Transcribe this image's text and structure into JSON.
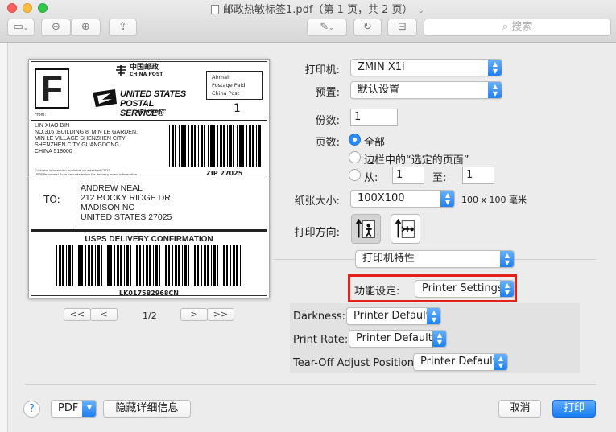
{
  "window": {
    "title": "邮政热敏标签1.pdf（第 1 页，共 2 页）",
    "search_placeholder": "搜索"
  },
  "label": {
    "sort_letter": "F",
    "from_label": "From:",
    "china_post_cn": "中国邮政",
    "china_post_en": "CHINA POST",
    "usps_line1": "UNITED STATES",
    "usps_line2": "POSTAL SERVICE®",
    "epacket": "ePacket™",
    "airmail_lines": [
      "Airmail",
      "Postage Paid",
      "China Post"
    ],
    "box_number": "1",
    "sender_lines": [
      "LIN XIAO BIN",
      "NO.316 ,BUILDING 8, MIN LE GARDEN,",
      "MIN LE VILLAGE SHENZHEN CITY",
      "SHENZHEN CITY GUANGDONG",
      "CHINA 518000"
    ],
    "customs_lines": [
      "Customs information available on attached CN22.",
      "USPS Personnel Scan barcode below for delivery event information"
    ],
    "zip": "ZIP 27025",
    "to_label": "TO:",
    "recipient_lines": [
      "ANDREW NEAL",
      "212 ROCKY RIDGE DR",
      "MADISON NC",
      "UNITED STATES 27025"
    ],
    "confirmation": "USPS DELIVERY CONFIRMATION",
    "tracking": "LK017582968CN"
  },
  "pager": {
    "first": "<<",
    "prev": "<",
    "indicator": "1/2",
    "next": ">",
    "last": ">>"
  },
  "form": {
    "printer_label": "打印机:",
    "printer_value": "ZMIN X1i",
    "preset_label": "预置:",
    "preset_value": "默认设置",
    "copies_label": "份数:",
    "copies_value": "1",
    "pages_label": "页数:",
    "pages_all": "全部",
    "pages_selected": "边栏中的“选定的页面”",
    "pages_from": "从:",
    "pages_from_value": "1",
    "pages_to": "至:",
    "pages_to_value": "1",
    "paper_label": "纸张大小:",
    "paper_value": "100X100",
    "paper_dims": "100 x 100 毫米",
    "orientation_label": "打印方向:",
    "section_value": "打印机特性",
    "feature_label": "功能设定:",
    "feature_value": "Printer Settings",
    "darkness_label": "Darkness:",
    "darkness_value": "Printer Default",
    "rate_label": "Print Rate:",
    "rate_value": "Printer Default",
    "tearoff_label": "Tear-Off Adjust Position:",
    "tearoff_value": "Printer Default"
  },
  "footer": {
    "help": "?",
    "pdf": "PDF",
    "hide_details": "隐藏详细信息",
    "cancel": "取消",
    "print": "打印"
  },
  "colors": {
    "accent": "#1a7cf2",
    "highlight_box": "#e3201b"
  }
}
